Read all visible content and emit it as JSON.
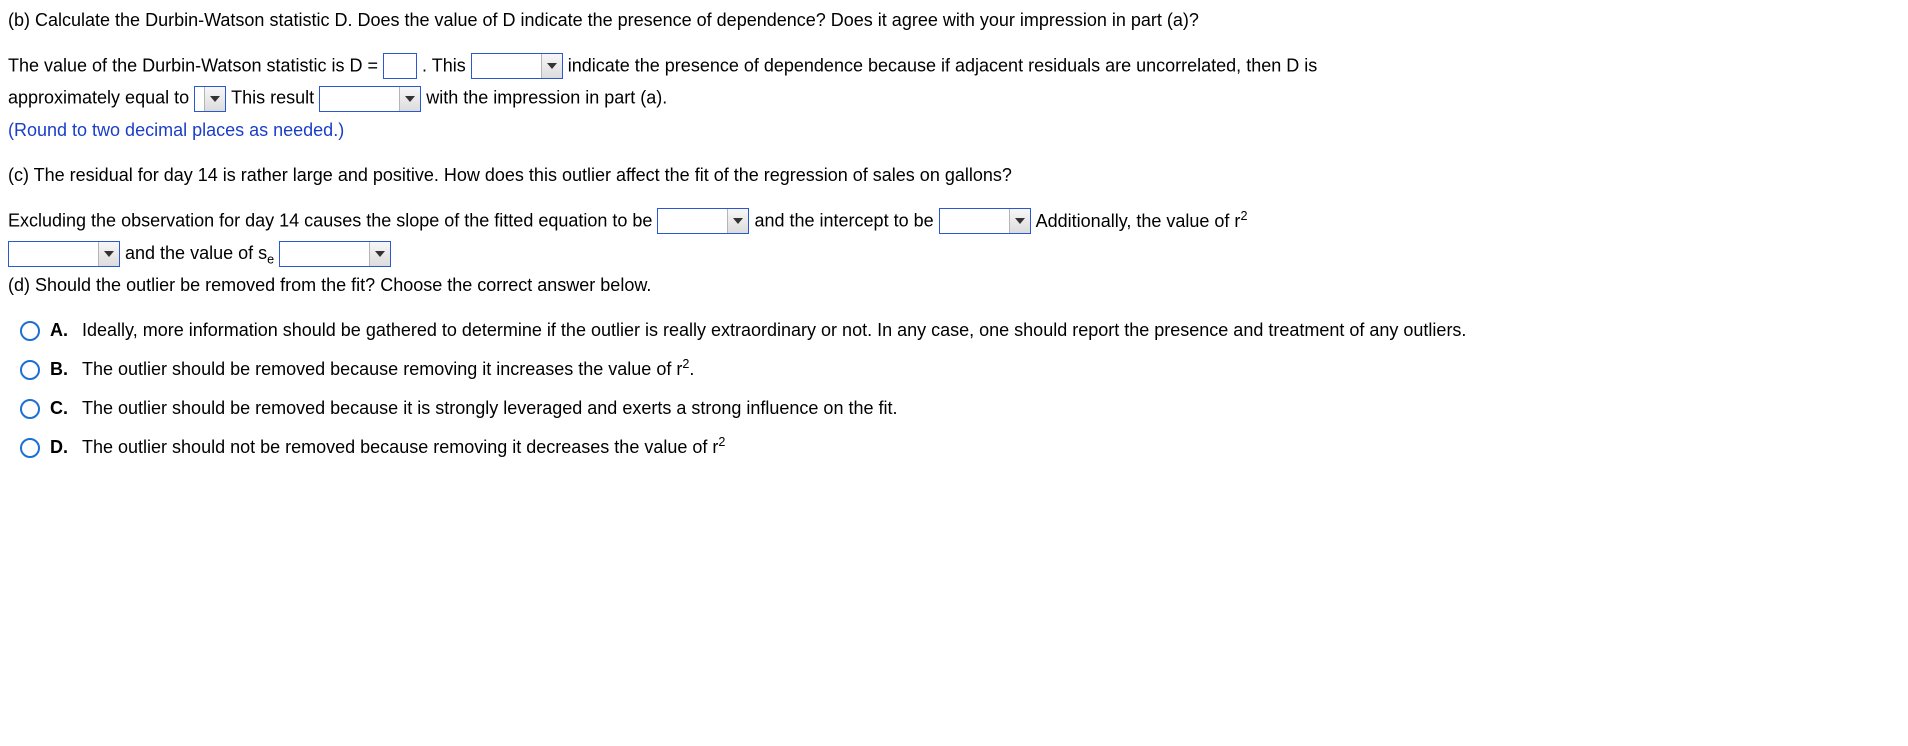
{
  "part_b": {
    "prompt": "(b) Calculate the Durbin-Watson statistic D. Does the value of D indicate the presence of dependence? Does it agree with your impression in part (a)?",
    "sentence": {
      "s1": "The value of the Durbin-Watson statistic is D =",
      "s2": ". This",
      "s3": "indicate the presence of dependence because if adjacent residuals are uncorrelated, then D is",
      "s4": "approximately equal to",
      "s5": "This result",
      "s6": "with the impression in part (a)."
    },
    "note": "(Round to two decimal places as needed.)"
  },
  "part_c": {
    "prompt": "(c) The residual for day 14 is rather large and positive. How does this outlier affect the fit of the regression of sales on gallons?",
    "sentence": {
      "s1": "Excluding the observation for day 14 causes the slope of the fitted equation to be",
      "s2": "and the intercept to be",
      "s3_pre": "Additionally, the value of r",
      "s4_pre": "and the value of s",
      "s4_sub": "e"
    }
  },
  "part_d": {
    "prompt": "(d) Should the outlier be removed from the fit? Choose the correct answer below.",
    "options": {
      "A": {
        "label": "A.",
        "text": "Ideally, more information should be gathered to determine if the outlier is really extraordinary or not. In any case, one should report the presence and treatment of any outliers."
      },
      "B": {
        "label": "B.",
        "text_pre": "The outlier should be removed because removing it increases the value of r",
        "text_post": "."
      },
      "C": {
        "label": "C.",
        "text": "The outlier should be removed because it is strongly leveraged and exerts a strong influence on the fit."
      },
      "D": {
        "label": "D.",
        "text_pre": "The outlier should not be removed because removing it decreases the value of r"
      }
    }
  }
}
